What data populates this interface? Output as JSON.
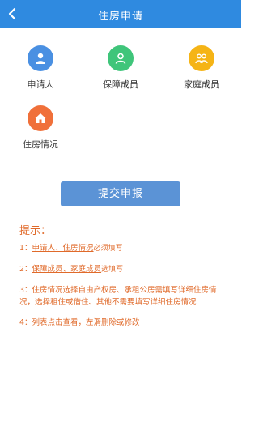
{
  "header": {
    "title": "住房申请"
  },
  "colors": {
    "nav": "#2f8ae0",
    "button": "#5b93d6",
    "tip": "#e06a2a"
  },
  "menu": [
    {
      "label": "申请人",
      "icon": "person-icon",
      "color": "#4a90e2"
    },
    {
      "label": "保障成员",
      "icon": "member-icon",
      "color": "#3fc57a"
    },
    {
      "label": "家庭成员",
      "icon": "family-icon",
      "color": "#f5b416"
    },
    {
      "label": "住房情况",
      "icon": "house-icon",
      "color": "#f0703a"
    }
  ],
  "submit_label": "提交申报",
  "tips": {
    "title": "提示：",
    "items": [
      {
        "num": "1：",
        "link": "申请人、住房情况",
        "suffix": "必须填写"
      },
      {
        "num": "2：",
        "link": "保障成员、家庭成员",
        "suffix": "选填写"
      },
      {
        "num": "3：",
        "text": "住房情况选择自由产权房、承租公房需填写详细住房情况，选择租住或借住、其他不需要填写详细住房情况"
      },
      {
        "num": "4：",
        "text": "列表点击查看，左滑删除或修改"
      }
    ]
  }
}
